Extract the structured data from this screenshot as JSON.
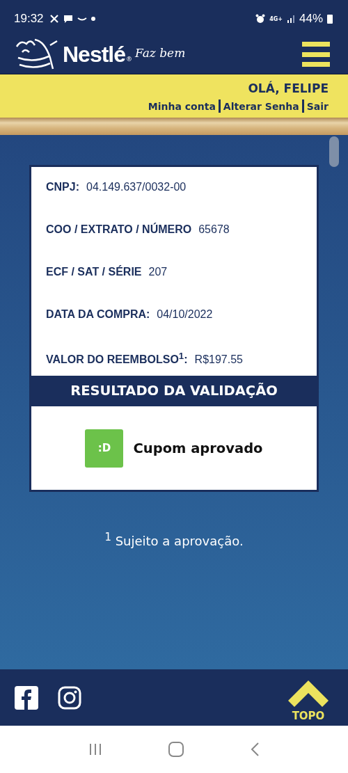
{
  "status_bar": {
    "time": "19:32",
    "network": "4G+",
    "battery": "44%"
  },
  "header": {
    "brand": "Nestlé",
    "registered": "®",
    "tagline": "Faz bem"
  },
  "user_bar": {
    "greeting": "OLÁ, FELIPE",
    "links": [
      "Minha conta",
      "Alterar Senha",
      "Sair"
    ]
  },
  "receipt": {
    "fields": [
      {
        "label": "CNPJ:",
        "value": "04.149.637/0032-00"
      },
      {
        "label": "COO / EXTRATO / NÚMERO",
        "value": "65678"
      },
      {
        "label": "ECF / SAT / SÉRIE",
        "value": "207"
      },
      {
        "label": "DATA DA COMPRA:",
        "value": "04/10/2022"
      },
      {
        "label": "VALOR DO REEMBOLSO$^{1}$:",
        "value": "R$197.55"
      }
    ],
    "result_title": "RESULTADO DA VALIDAÇÃO",
    "result": {
      "kind": "approved",
      "badge": ":D",
      "text": "Cupom aprovado"
    }
  },
  "footnote": "$^{1}$ Sujeito a aprovação.",
  "footer": {
    "top_label": "TOPO"
  }
}
